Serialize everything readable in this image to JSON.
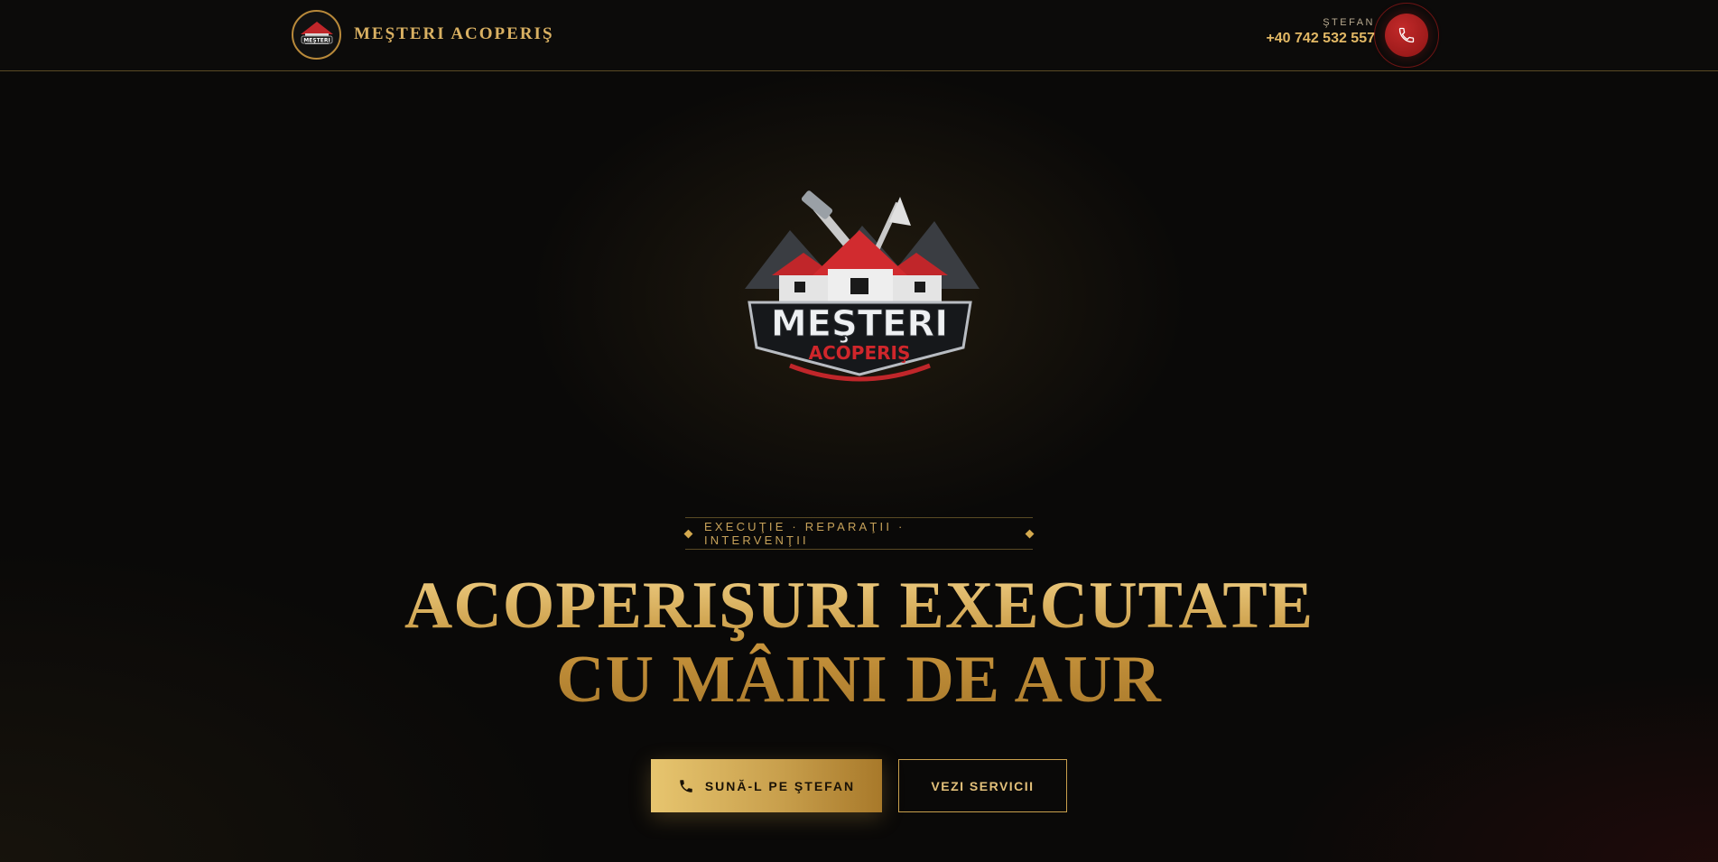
{
  "header": {
    "brand_name": "MEŞTERI ACOPERIŞ",
    "brand_logo_text": "MEŞTERI",
    "contact_label": "ŞTEFAN",
    "contact_phone": "+40 742 532 557",
    "call_icon": "phone-icon"
  },
  "hero": {
    "logo": {
      "title": "MEŞTERI",
      "subtitle": "ACOPERIŞ"
    },
    "tagline": "EXECUŢIE · REPARAŢII · INTERVENŢII",
    "headline_line1": "Acoperişuri executate",
    "headline_line2": "cu mâini de aur",
    "primary_button": {
      "label": "SUNĂ-L PE ŞTEFAN",
      "icon": "phone-icon"
    },
    "secondary_button": {
      "label": "VEZI SERVICII"
    }
  },
  "colors": {
    "background": "#0a0908",
    "gold": "#d4a94e",
    "accent_red": "#b51f1f"
  }
}
